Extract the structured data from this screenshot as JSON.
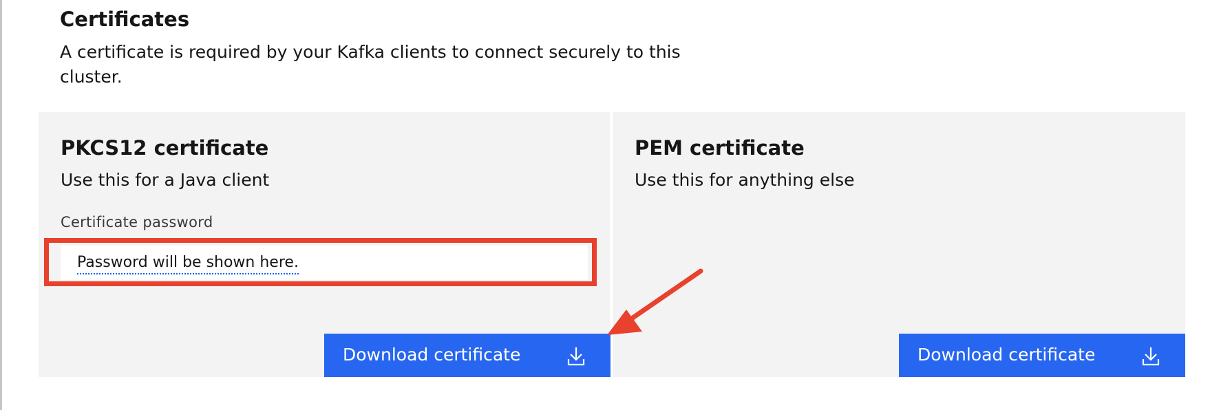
{
  "section": {
    "title": "Certificates",
    "description": "A certificate is required by your Kafka clients to connect securely to this cluster."
  },
  "pkcs12": {
    "title": "PKCS12 certificate",
    "subtitle": "Use this for a Java client",
    "password_label": "Certificate password",
    "password_value": "Password will be shown here.",
    "download_label": "Download certificate",
    "download_icon": "download-icon"
  },
  "pem": {
    "title": "PEM certificate",
    "subtitle": "Use this for anything else",
    "download_label": "Download certificate",
    "download_icon": "download-icon"
  },
  "colors": {
    "button_bg": "#2766f0",
    "tile_bg": "#f3f3f3",
    "annotation_red": "#e8412d"
  }
}
